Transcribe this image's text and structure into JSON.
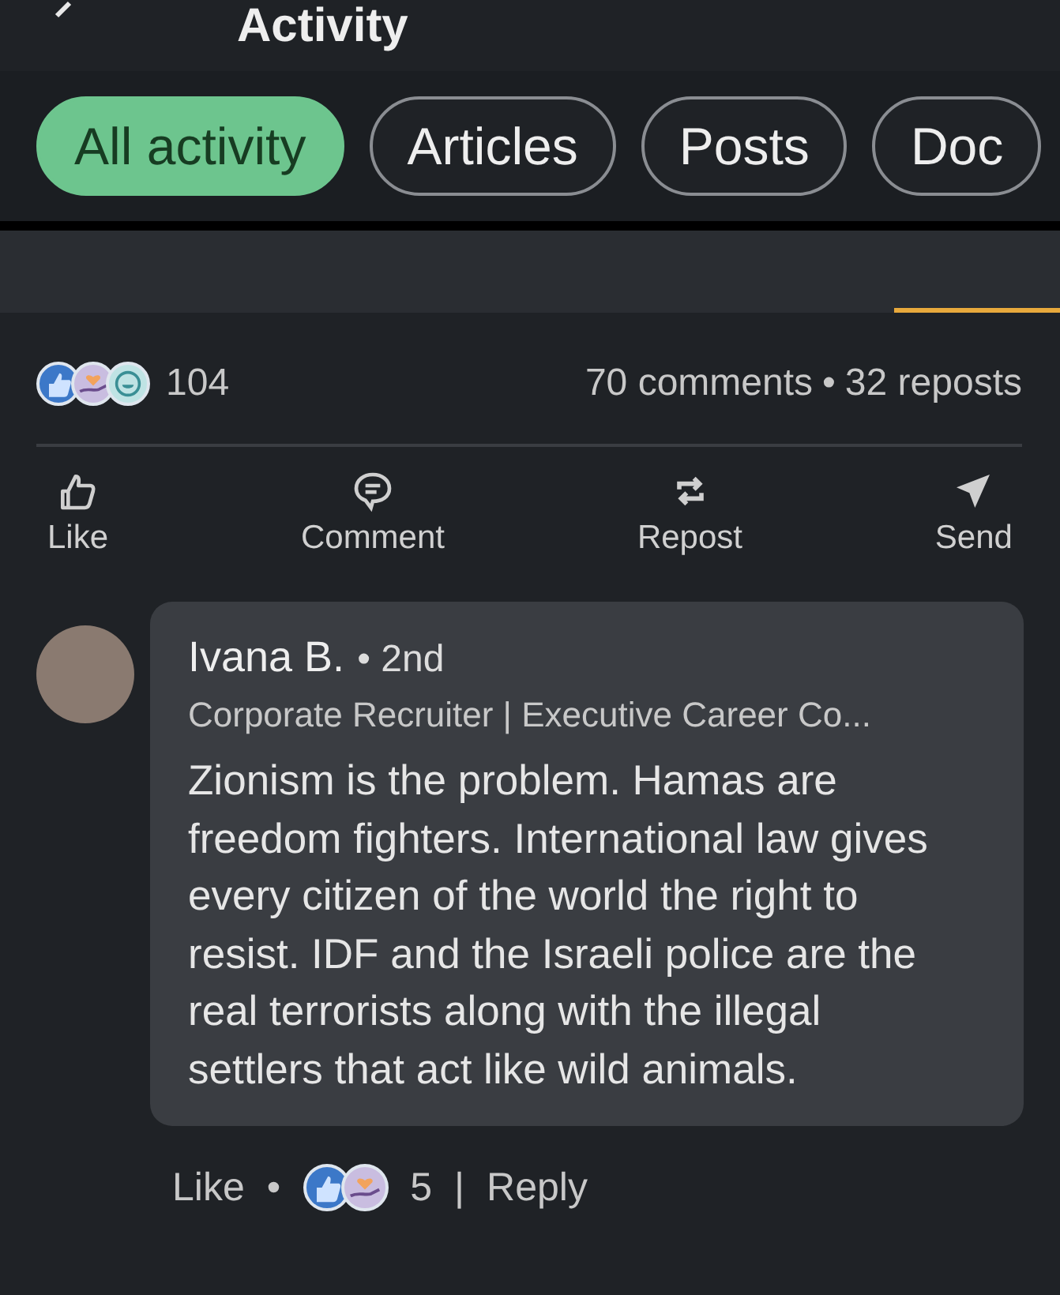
{
  "header": {
    "title": "Activity"
  },
  "filters": [
    {
      "label": "All activity",
      "selected": true
    },
    {
      "label": "Articles",
      "selected": false
    },
    {
      "label": "Posts",
      "selected": false
    },
    {
      "label": "Doc",
      "selected": false
    }
  ],
  "post": {
    "reactions": [
      {
        "kind": "like"
      },
      {
        "kind": "support"
      },
      {
        "kind": "funny"
      }
    ],
    "reaction_count": "104",
    "comments": "70 comments",
    "separator": "•",
    "reposts": "32 reposts",
    "actions": [
      {
        "kind": "like",
        "label": "Like"
      },
      {
        "kind": "comment",
        "label": "Comment"
      },
      {
        "kind": "repost",
        "label": "Repost"
      },
      {
        "kind": "send",
        "label": "Send"
      }
    ]
  },
  "comment": {
    "author": "Ivana B.",
    "degree": "• 2nd",
    "headline": "Corporate Recruiter | Executive Career Co...",
    "text": "Zionism is the problem. Hamas are freedom fighters. International law gives every citizen of the world the right to resist. IDF and the Israeli police are the real terrorists along with the illegal settlers that act like wild animals.",
    "like_label": "Like",
    "dot": "•",
    "reactions": [
      {
        "kind": "like"
      },
      {
        "kind": "support"
      }
    ],
    "reaction_count": "5",
    "bar": "|",
    "reply_label": "Reply"
  }
}
